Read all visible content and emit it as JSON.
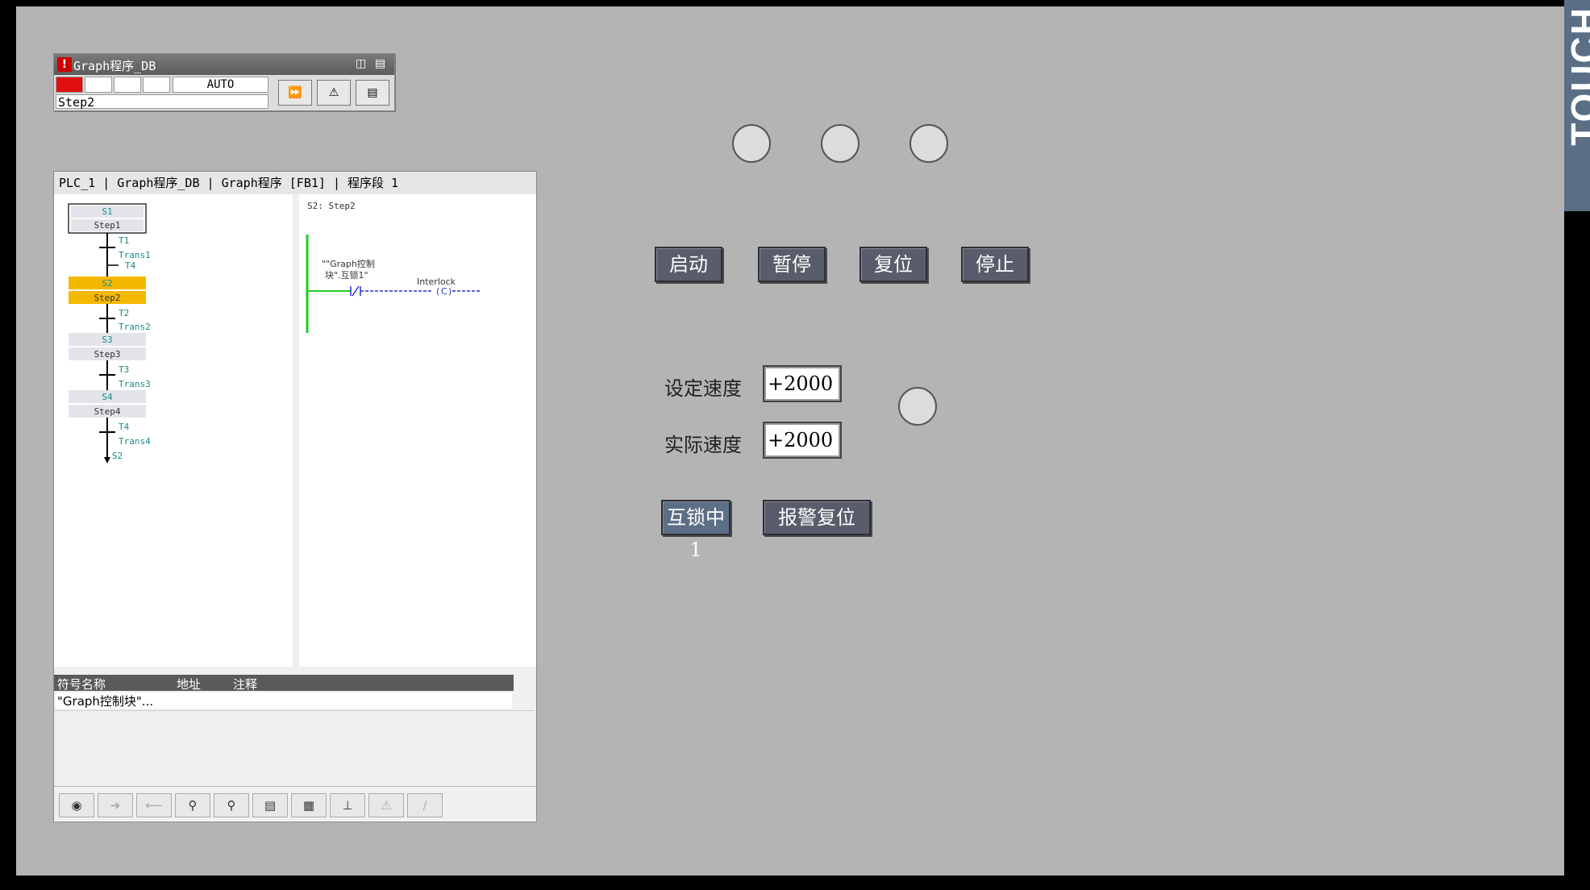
{
  "side_text": "TOUCH",
  "graph_status": {
    "title": "Graph程序_DB",
    "mode": "AUTO",
    "step": "Step2",
    "active_color": "#e01010"
  },
  "program": {
    "path": "PLC_1 | Graph程序_DB | Graph程序 [FB1] | 程序段 1",
    "detail_header": "S2: Step2",
    "operand_line1": "\"\"Graph控制",
    "operand_line2": "块\".互锁1\"",
    "interlock_label": "Interlock",
    "coil_label": "C",
    "steps": [
      {
        "id": "S1",
        "name": "Step1"
      },
      {
        "id": "S2",
        "name": "Step2"
      },
      {
        "id": "S3",
        "name": "Step3"
      },
      {
        "id": "S4",
        "name": "Step4"
      }
    ],
    "transitions": [
      {
        "id": "T1",
        "name": "Trans1"
      },
      {
        "id": "T2",
        "name": "Trans2"
      },
      {
        "id": "T3",
        "name": "Trans3"
      },
      {
        "id": "T4",
        "name": "Trans4"
      }
    ],
    "loop_in": "T4",
    "jump_to": "S2",
    "active_step_color": "#f5b800",
    "symbol_table": {
      "col_name": "符号名称",
      "col_address": "地址",
      "col_comment": "注释",
      "row1_name": "\"Graph控制块\"..."
    }
  },
  "hmi": {
    "buttons": {
      "start": "启动",
      "pause": "暂停",
      "reset": "复位",
      "stop": "停止",
      "interlock": "互锁中1",
      "alarm_reset": "报警复位"
    },
    "set_speed_label": "设定速度",
    "set_speed_value": "+2000",
    "actual_speed_label": "实际速度",
    "actual_speed_value": "+2000"
  }
}
